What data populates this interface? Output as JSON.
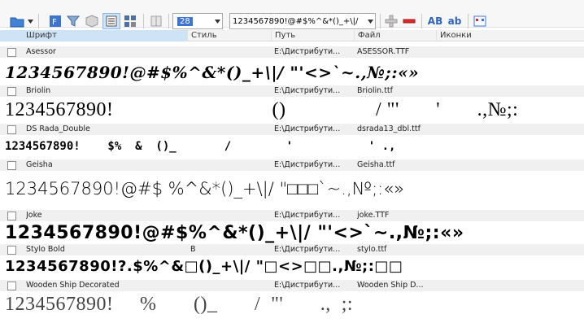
{
  "toolbar": {
    "size_value": "28",
    "sample_value": "1234567890!@#$%^&*()_+\\|/",
    "bold_label": "AB",
    "lower_label": "ab"
  },
  "columns": {
    "font": "Шрифт",
    "style": "Стиль",
    "path": "Путь",
    "file": "Файл",
    "icons": "Иконки"
  },
  "rows": [
    {
      "name": "Asessor",
      "style": "",
      "path": "E:\\Дистрибути...",
      "file": "ASESSOR.TTF",
      "sample": "1234567890!@#$%^&*()_+\\|/ \"'<>`~.,№;:«»"
    },
    {
      "name": "Briolin",
      "style": "",
      "path": "E:\\Дистрибути...",
      "file": "Briolin.ttf",
      "sample": "1234567890!                              ()                 / \"'       '       .,№;:"
    },
    {
      "name": "DS Rada_Double",
      "style": "",
      "path": "E:\\Дистрибути...",
      "file": "dsrada13_dbl.ttf",
      "sample": "1234567890!    $%  &  ()_       /        '           ' .,"
    },
    {
      "name": "Geisha",
      "style": "",
      "path": "E:\\Дистрибути...",
      "file": "Geisha.ttf",
      "sample": "1234567890!@#$ %^&*()_+\\|/ \"□□□`~.,№;:«»"
    },
    {
      "name": "Joke",
      "style": "",
      "path": "E:\\Дистрибути...",
      "file": "joke.TTF",
      "sample": "1234567890!@#$%^&*()_+\\|/ \"'<>`~.,№;:«»"
    },
    {
      "name": "Stylo Bold",
      "style": "B",
      "path": "E:\\Дистрибути...",
      "file": "stylo.ttf",
      "sample": "1234567890!?.$%^&□()_+\\|/ \"□<>□□.,№;:□□"
    },
    {
      "name": "Wooden Ship Decorated",
      "style": "",
      "path": "E:\\Дистрибути...",
      "file": "Wooden Ship D...",
      "sample": "1234567890!     %       ()_       /  \"'       .,  ;:"
    }
  ]
}
